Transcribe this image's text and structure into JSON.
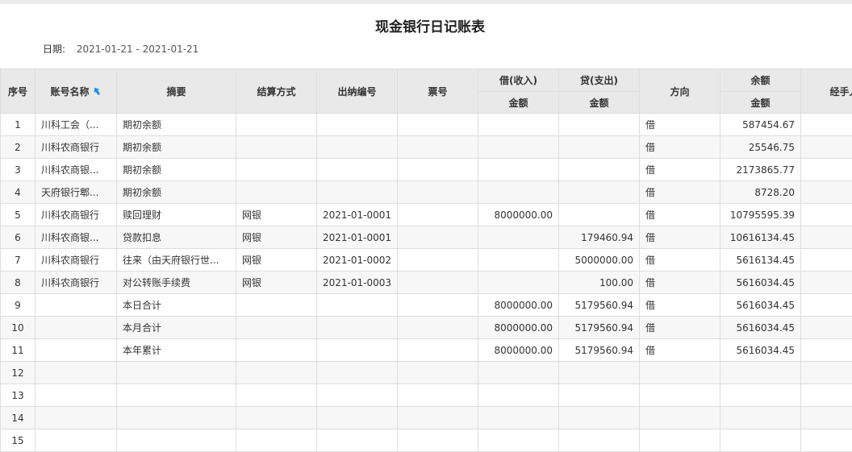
{
  "report": {
    "title": "现金银行日记账表",
    "date_label": "日期:",
    "date_range": "2021-01-21 - 2021-01-21"
  },
  "columns": {
    "seq": "序号",
    "account": "账号名称",
    "summary": "摘要",
    "settlement": "结算方式",
    "cashier_no": "出纳编号",
    "ticket_no": "票号",
    "debit_group": "借(收入)",
    "credit_group": "贷(支出)",
    "direction": "方向",
    "balance_group": "余额",
    "handler": "经手人",
    "amount": "金额"
  },
  "rows": [
    {
      "seq": "1",
      "account": "川科工会（...",
      "summary": "期初余额",
      "settlement": "",
      "cashier_no": "",
      "ticket_no": "",
      "debit": "",
      "credit": "",
      "direction": "借",
      "balance": "587454.67"
    },
    {
      "seq": "2",
      "account": "川科农商银行",
      "summary": "期初余额",
      "settlement": "",
      "cashier_no": "",
      "ticket_no": "",
      "debit": "",
      "credit": "",
      "direction": "借",
      "balance": "25546.75"
    },
    {
      "seq": "3",
      "account": "川科农商银...",
      "summary": "期初余额",
      "settlement": "",
      "cashier_no": "",
      "ticket_no": "",
      "debit": "",
      "credit": "",
      "direction": "借",
      "balance": "2173865.77"
    },
    {
      "seq": "4",
      "account": "天府银行郫...",
      "summary": "期初余额",
      "settlement": "",
      "cashier_no": "",
      "ticket_no": "",
      "debit": "",
      "credit": "",
      "direction": "借",
      "balance": "8728.20"
    },
    {
      "seq": "5",
      "account": "川科农商银行",
      "summary": "赎回理财",
      "settlement": "网银",
      "cashier_no": "2021-01-0001",
      "ticket_no": "",
      "debit": "8000000.00",
      "credit": "",
      "direction": "借",
      "balance": "10795595.39"
    },
    {
      "seq": "6",
      "account": "川科农商银...",
      "summary": "贷款扣息",
      "settlement": "网银",
      "cashier_no": "2021-01-0001",
      "ticket_no": "",
      "debit": "",
      "credit": "179460.94",
      "direction": "借",
      "balance": "10616134.45"
    },
    {
      "seq": "7",
      "account": "川科农商银行",
      "summary": "往来（由天府银行世...",
      "settlement": "网银",
      "cashier_no": "2021-01-0002",
      "ticket_no": "",
      "debit": "",
      "credit": "5000000.00",
      "direction": "借",
      "balance": "5616134.45"
    },
    {
      "seq": "8",
      "account": "川科农商银行",
      "summary": "对公转账手续费",
      "settlement": "网银",
      "cashier_no": "2021-01-0003",
      "ticket_no": "",
      "debit": "",
      "credit": "100.00",
      "direction": "借",
      "balance": "5616034.45"
    },
    {
      "seq": "9",
      "account": "",
      "summary": "本日合计",
      "settlement": "",
      "cashier_no": "",
      "ticket_no": "",
      "debit": "8000000.00",
      "credit": "5179560.94",
      "direction": "借",
      "balance": "5616034.45"
    },
    {
      "seq": "10",
      "account": "",
      "summary": "本月合计",
      "settlement": "",
      "cashier_no": "",
      "ticket_no": "",
      "debit": "8000000.00",
      "credit": "5179560.94",
      "direction": "借",
      "balance": "5616034.45"
    },
    {
      "seq": "11",
      "account": "",
      "summary": "本年累计",
      "settlement": "",
      "cashier_no": "",
      "ticket_no": "",
      "debit": "8000000.00",
      "credit": "5179560.94",
      "direction": "借",
      "balance": "5616034.45"
    },
    {
      "seq": "12",
      "account": "",
      "summary": "",
      "settlement": "",
      "cashier_no": "",
      "ticket_no": "",
      "debit": "",
      "credit": "",
      "direction": "",
      "balance": ""
    },
    {
      "seq": "13",
      "account": "",
      "summary": "",
      "settlement": "",
      "cashier_no": "",
      "ticket_no": "",
      "debit": "",
      "credit": "",
      "direction": "",
      "balance": ""
    },
    {
      "seq": "14",
      "account": "",
      "summary": "",
      "settlement": "",
      "cashier_no": "",
      "ticket_no": "",
      "debit": "",
      "credit": "",
      "direction": "",
      "balance": ""
    },
    {
      "seq": "15",
      "account": "",
      "summary": "",
      "settlement": "",
      "cashier_no": "",
      "ticket_no": "",
      "debit": "",
      "credit": "",
      "direction": "",
      "balance": ""
    }
  ],
  "colors": {
    "header_bg": "#e9e9e9",
    "account_text": "#2e6b1f",
    "sort_icon": "#1a8fe3"
  },
  "icons": {
    "account_header": "sort-icon"
  }
}
